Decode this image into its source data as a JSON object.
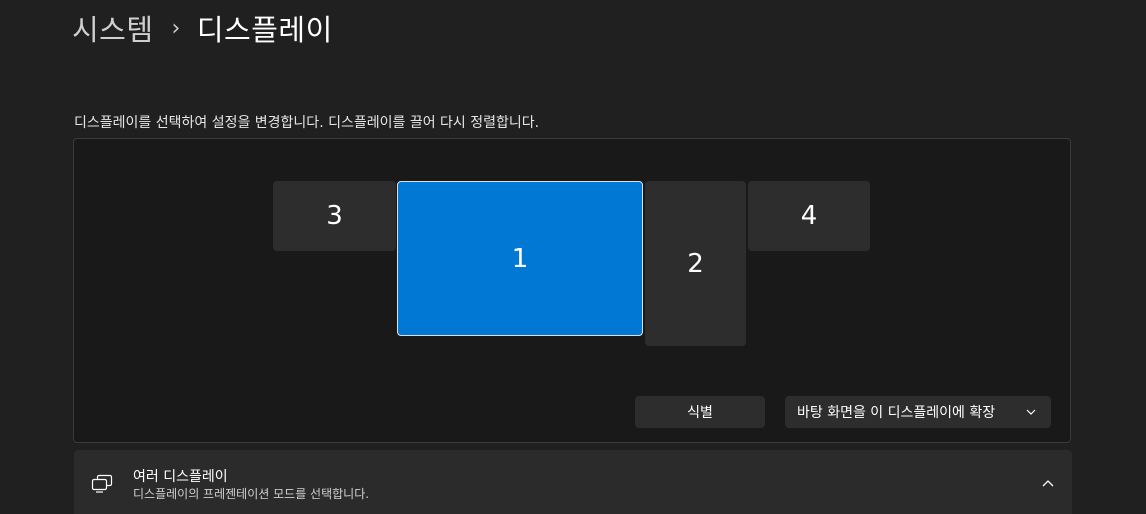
{
  "breadcrumb": {
    "parent": "시스템",
    "separator": "›",
    "current": "디스플레이"
  },
  "instructions": "디스플레이를 선택하여 설정을 변경합니다. 디스플레이를 끌어 다시 정렬합니다.",
  "monitors": [
    {
      "label": "3",
      "selected": false
    },
    {
      "label": "1",
      "selected": true
    },
    {
      "label": "2",
      "selected": false
    },
    {
      "label": "4",
      "selected": false
    }
  ],
  "identify_label": "식별",
  "display_mode": {
    "selected": "바탕 화면을 이 디스플레이에 확장",
    "icon": "chevron-down-icon"
  },
  "multi_display": {
    "title": "여러 디스플레이",
    "subtitle": "디스플레이의 프레젠테이션 모드를 선택합니다.",
    "icon": "multiple-monitors-icon",
    "expand_icon": "chevron-up-icon"
  },
  "colors": {
    "background": "#202020",
    "panel": "#191919",
    "accent": "#0078d4",
    "monitor": "#2d2d2d"
  }
}
